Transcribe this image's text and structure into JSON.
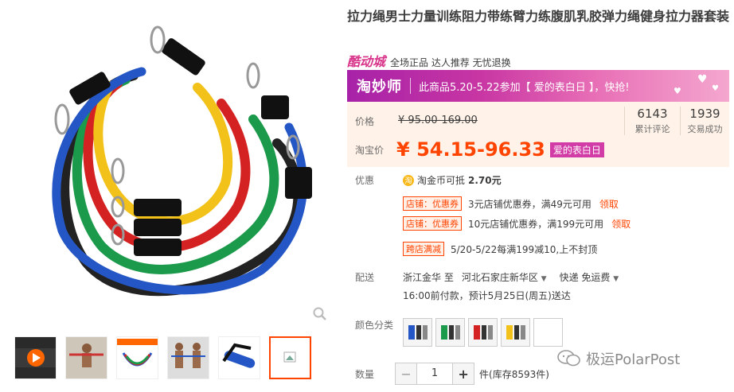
{
  "product": {
    "title": "拉力绳男士力量训练阻力带练臂力练腹肌乳胶弹力绳健身拉力器套装"
  },
  "mall": {
    "logo": "酷动城",
    "slogan": "全场正品 达人推荐 无忧退换"
  },
  "banner": {
    "brand": "淘妙师",
    "message": "此商品5.20-5.22参加【 爱的表白日 】，快抢!"
  },
  "price": {
    "label": "价格",
    "original": "¥ 95.00-169.00",
    "promo_label": "淘宝价",
    "current": "¥ 54.15-96.33",
    "badge": "爱的表白日",
    "reviews_count": "6143",
    "reviews_label": "累计评论",
    "deals_count": "1939",
    "deals_label": "交易成功"
  },
  "discount": {
    "label": "优惠",
    "coin_text": "淘金币可抵",
    "coin_value": "2.70元",
    "coupons": [
      {
        "tag": "店铺：优惠券",
        "text": "3元店铺优惠券，满49元可用",
        "link": "领取"
      },
      {
        "tag": "店铺：优惠券",
        "text": "10元店铺优惠券，满199元可用",
        "link": "领取"
      }
    ],
    "manjian_tag": "跨店满减",
    "manjian_text": "5/20-5/22每满199减10,上不封顶"
  },
  "delivery": {
    "label": "配送",
    "from": "浙江金华 至",
    "to": "河北石家庄新华区",
    "method": "快递 免运费",
    "eta": "16:00前付款，预计5月25日(周五)送达"
  },
  "color": {
    "label": "颜色分类"
  },
  "quantity": {
    "label": "数量",
    "value": "1",
    "minus": "−",
    "plus": "+",
    "stock": "件(库存8593件)"
  },
  "watermark": "极运PolarPost",
  "colors": {
    "accent": "#ff4400",
    "banner_purple": "#a722a8",
    "badge_pink": "#d13ca6",
    "price_bg": "#fff2e8"
  }
}
